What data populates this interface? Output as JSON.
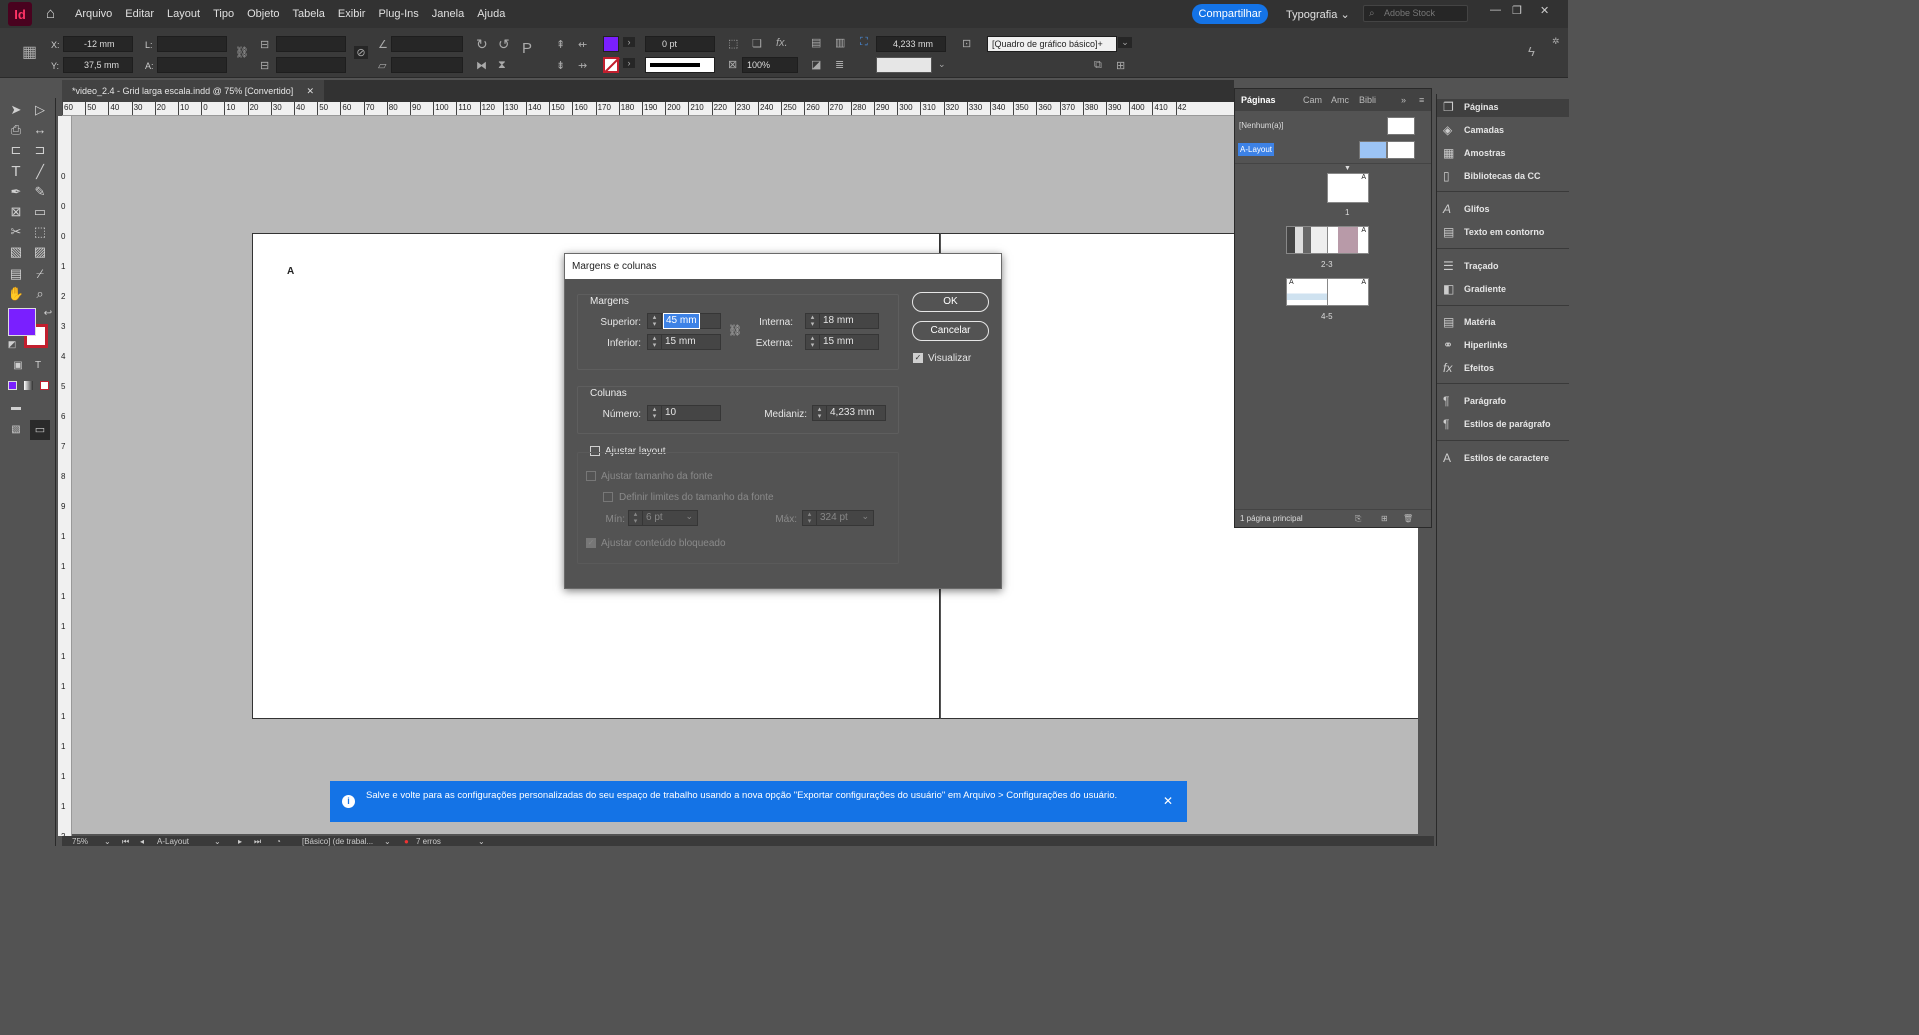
{
  "app": {
    "logo_text": "Id",
    "menu": [
      "Arquivo",
      "Editar",
      "Layout",
      "Tipo",
      "Objeto",
      "Tabela",
      "Exibir",
      "Plug-Ins",
      "Janela",
      "Ajuda"
    ],
    "share_label": "Compartilhar",
    "workspace_label": "Typografia",
    "stock_placeholder": "Adobe Stock"
  },
  "control_panel": {
    "x_label": "X:",
    "x_value": "-12 mm",
    "y_label": "Y:",
    "y_value": "37,5 mm",
    "w_label": "L:",
    "h_label": "A:",
    "stroke_weight": "0 pt",
    "opacity": "100%",
    "gutter_value": "4,233 mm",
    "frame_style": "[Quadro de gráfico básico]+",
    "fill_color": "#7A1FFF"
  },
  "document": {
    "tab_title": "*video_2.4 - Grid larga escala.indd @ 75% [Convertido]",
    "page_master_letter": "A",
    "ruler_h": [
      "60",
      "50",
      "40",
      "30",
      "20",
      "10",
      "0",
      "10",
      "20",
      "30",
      "40",
      "50",
      "60",
      "70",
      "80",
      "90",
      "100",
      "110",
      "120",
      "130",
      "140",
      "150",
      "160",
      "170",
      "180",
      "190",
      "200",
      "210",
      "220",
      "230",
      "240",
      "250",
      "260",
      "270",
      "280",
      "290",
      "300",
      "310",
      "320",
      "330",
      "340",
      "350",
      "360",
      "370",
      "380",
      "390",
      "400",
      "410",
      "42"
    ],
    "ruler_v": [
      "0",
      "0",
      "0",
      "1",
      "2",
      "3",
      "4",
      "5",
      "6",
      "7",
      "8",
      "9",
      "1",
      "1",
      "1",
      "1",
      "1",
      "1",
      "1",
      "1",
      "1",
      "1",
      "2",
      "2"
    ]
  },
  "dialog": {
    "title": "Margens e colunas",
    "margins_group": "Margens",
    "top_label": "Superior:",
    "top_value": "45 mm",
    "bottom_label": "Inferior:",
    "bottom_value": "15 mm",
    "inside_label": "Interna:",
    "inside_value": "18 mm",
    "outside_label": "Externa:",
    "outside_value": "15 mm",
    "columns_group": "Colunas",
    "number_label": "Número:",
    "number_value": "10",
    "gutter_label": "Medianiz:",
    "gutter_value": "4,233 mm",
    "adjust_layout_label": "Ajustar layout",
    "adjust_font_label": "Ajustar tamanho da fonte",
    "font_limits_label": "Definir limites do tamanho da fonte",
    "min_label": "Mín:",
    "min_value": "6 pt",
    "max_label": "Máx:",
    "max_value": "324 pt",
    "locked_label": "Ajustar conteúdo bloqueado",
    "ok_label": "OK",
    "cancel_label": "Cancelar",
    "preview_label": "Visualizar",
    "preview_checked": true
  },
  "pages_panel": {
    "tabs": [
      "Páginas",
      "Cam",
      "Amc",
      "Bibli"
    ],
    "none_master": "[Nenhum(a)]",
    "a_master": "A-Layout",
    "page_labels": [
      "1",
      "2-3",
      "4-5"
    ],
    "master_letter": "A",
    "footer": "1 página principal"
  },
  "dock": {
    "items": [
      "Páginas",
      "Camadas",
      "Amostras",
      "Bibliotecas da CC",
      "Glifos",
      "Texto em contorno",
      "Traçado",
      "Gradiente",
      "Matéria",
      "Hiperlinks",
      "Efeitos",
      "Parágrafo",
      "Estilos de parágrafo",
      "Estilos de caractere"
    ]
  },
  "notice": {
    "text": "Salve e volte para as configurações personalizadas do seu espaço de trabalho usando a nova opção \"Exportar configurações do usuário\" em Arquivo > Configurações do usuário."
  },
  "status": {
    "zoom": "75%",
    "page": "A-Layout",
    "profile": "[Básico] (de trabal...",
    "errors": "7 erros"
  }
}
